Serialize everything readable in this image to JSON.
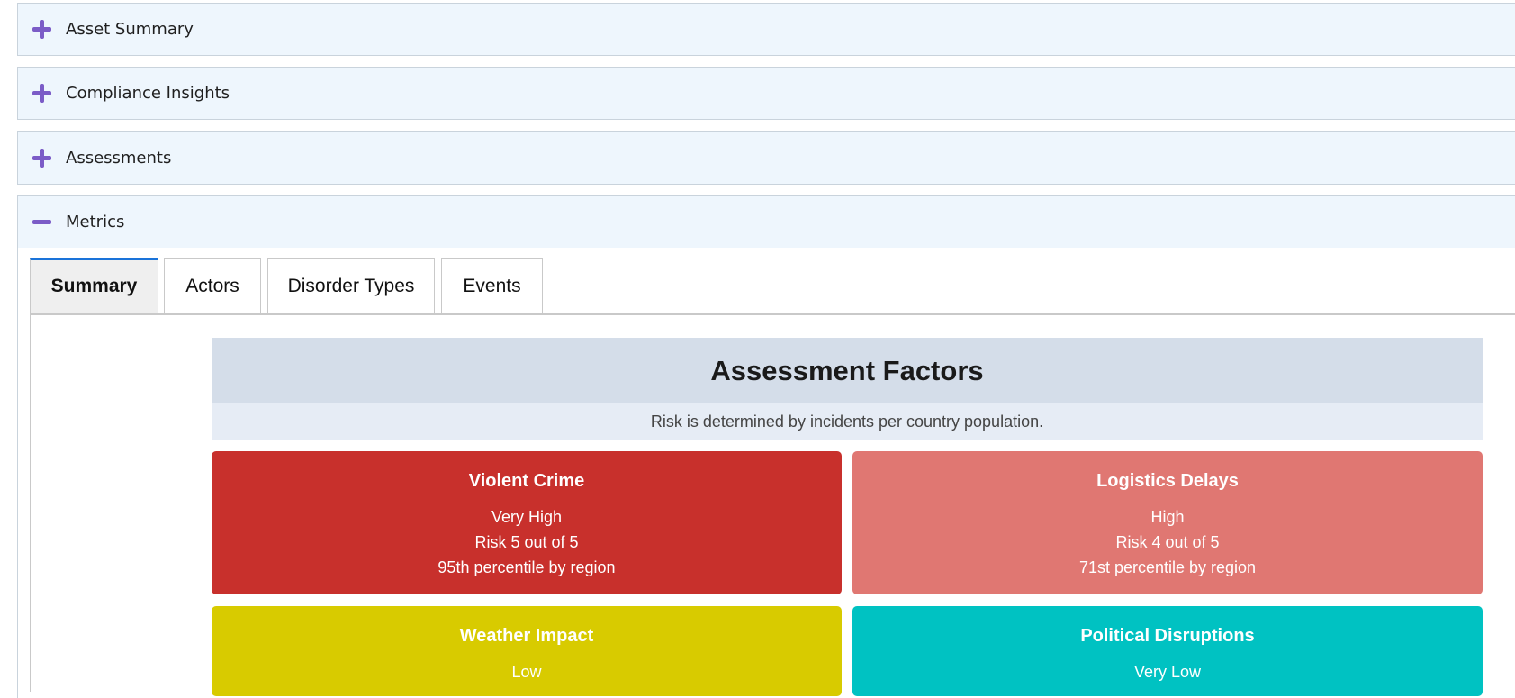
{
  "accordions": [
    {
      "label": "Asset Summary",
      "state": "collapsed"
    },
    {
      "label": "Compliance Insights",
      "state": "collapsed"
    },
    {
      "label": "Assessments",
      "state": "collapsed"
    },
    {
      "label": "Metrics",
      "state": "expanded"
    }
  ],
  "tabs": [
    {
      "label": "Summary",
      "active": true
    },
    {
      "label": "Actors",
      "active": false
    },
    {
      "label": "Disorder Types",
      "active": false
    },
    {
      "label": "Events",
      "active": false
    }
  ],
  "factors": {
    "title": "Assessment Factors",
    "subtitle": "Risk is determined by incidents per country population.",
    "cards": [
      {
        "name": "Violent Crime",
        "level": "Very High",
        "risk": "Risk 5 out of 5",
        "percentile": "95th percentile by region",
        "color": "#c8302c"
      },
      {
        "name": "Logistics Delays",
        "level": "High",
        "risk": "Risk 4 out of 5",
        "percentile": "71st percentile by region",
        "color": "#e07772"
      },
      {
        "name": "Weather Impact",
        "level": "Low",
        "color": "#d8cb00"
      },
      {
        "name": "Political Disruptions",
        "level": "Very Low",
        "color": "#00c2c2"
      }
    ]
  },
  "colors": {
    "accent": "#7b5cc7",
    "accordion_bg": "#eef6fd",
    "tab_active_border": "#1a73d9"
  }
}
